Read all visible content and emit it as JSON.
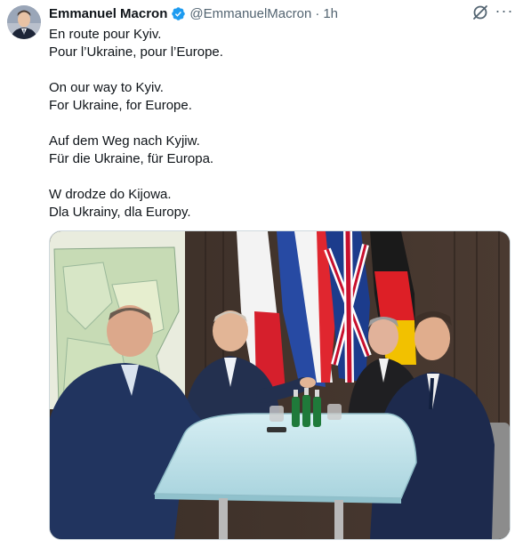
{
  "author": {
    "display_name": "Emmanuel Macron",
    "handle": "@EmmanuelMacron",
    "separator": "·",
    "time": "1h",
    "verified_icon": "verified-badge-icon"
  },
  "actions": {
    "grok_icon": "grok-icon",
    "more_icon": "more-icon",
    "more_glyph": "···"
  },
  "tweet": {
    "paragraphs": [
      [
        "En route pour Kyiv.",
        "Pour l’Ukraine, pour l’Europe."
      ],
      [
        "On our way to Kyiv.",
        "For Ukraine, for Europe."
      ],
      [
        "Auf dem Weg nach Kyjiw.",
        "Für die Ukraine, für Europa."
      ],
      [
        "W drodze do Kijowa.",
        "Dla Ukrainy, dla Europy."
      ]
    ]
  },
  "colors": {
    "text": "#0f1419",
    "secondary": "#536471",
    "verified_blue": "#1d9bf0",
    "border": "#cfd9de"
  }
}
